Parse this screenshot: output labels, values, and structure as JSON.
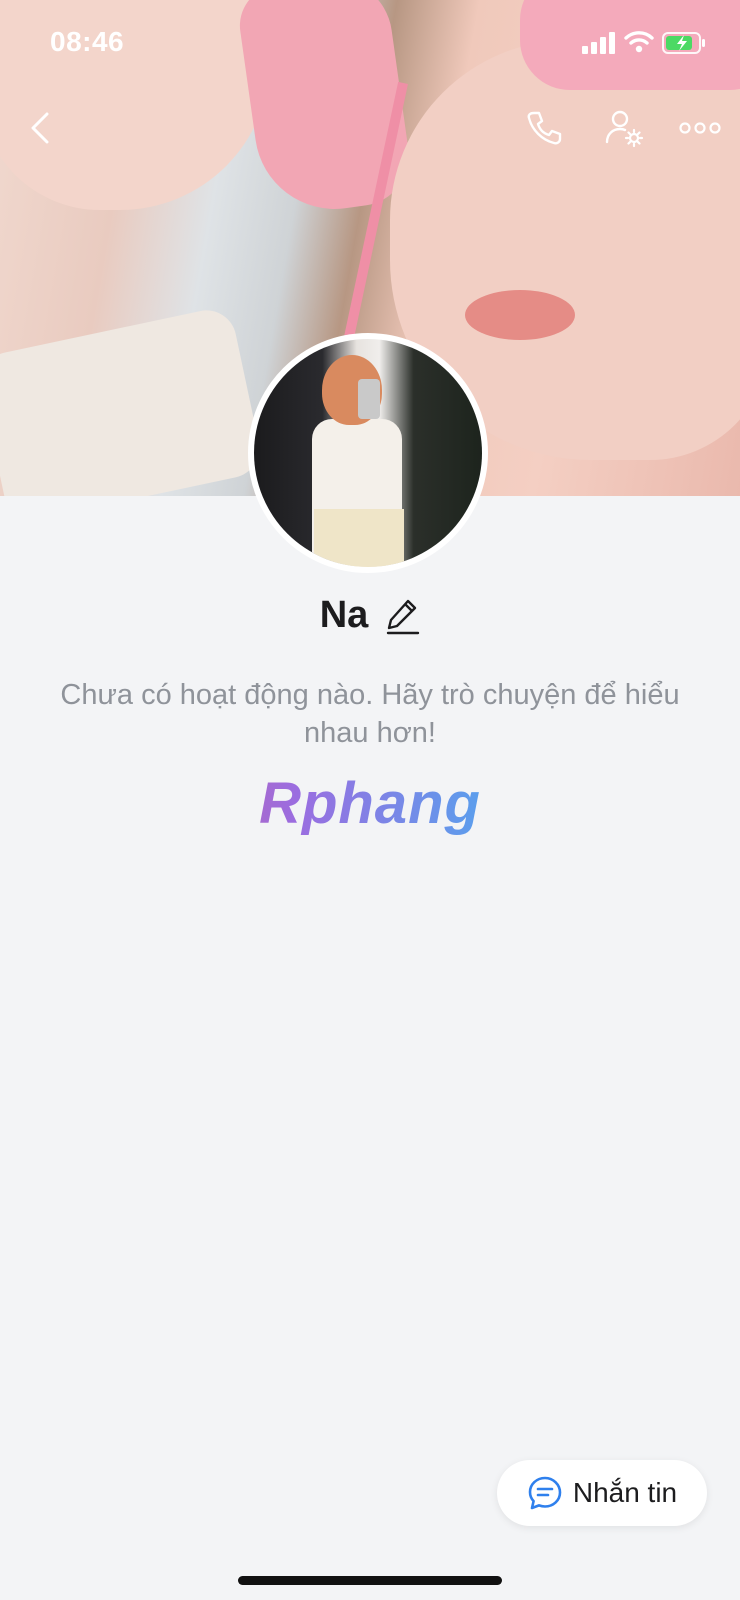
{
  "status_bar": {
    "time": "08:46"
  },
  "profile": {
    "name": "Na",
    "empty_activity_text": "Chưa có hoạt động nào. Hãy trò chuyện để hiểu nhau hơn!",
    "watermark": "Rphang"
  },
  "actions": {
    "message_button": "Nhắn tin"
  },
  "icons": {
    "back": "back-chevron-icon",
    "call": "phone-icon",
    "profile_settings": "user-settings-icon",
    "more": "more-dots-icon",
    "edit": "pencil-icon",
    "message": "chat-bubble-icon"
  },
  "colors": {
    "accent": "#2f80ed",
    "background": "#f3f4f6"
  }
}
